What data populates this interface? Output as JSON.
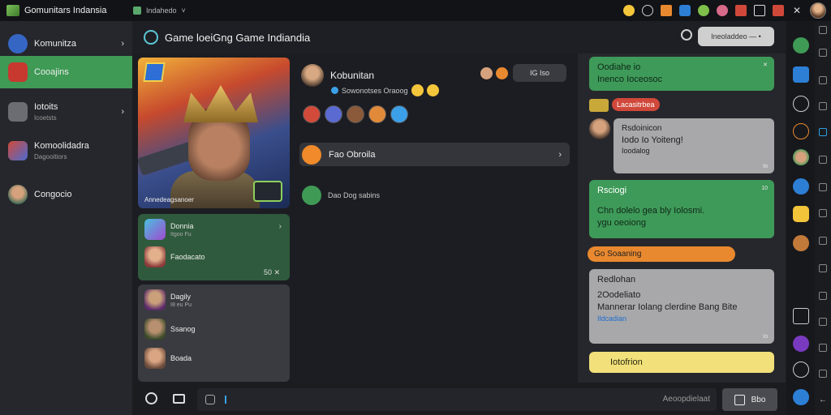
{
  "window": {
    "brand": "Gomunitars Indansia",
    "sub_title": "Indahedo",
    "sub_arrow": "˅"
  },
  "sidebar": {
    "items": [
      {
        "label": "Komunitza",
        "sub": "",
        "chevron": "›"
      },
      {
        "label": "Cooajins",
        "sub": ""
      },
      {
        "label": "Iotoits",
        "sub": "Icoetsts",
        "chevron": "›"
      },
      {
        "label": "Komoolidadra",
        "sub": "Dagooitiors"
      },
      {
        "label": "Congocio",
        "sub": ""
      }
    ]
  },
  "header": {
    "title": "Game loeiGng Game Indiandia",
    "button_label": "Ineoladdeo — •"
  },
  "hero": {
    "caption": "Annedeagsanoer"
  },
  "panel1": {
    "items": [
      {
        "label": "Donnia",
        "sub": "Itgoo Fu"
      },
      {
        "label": "Faodacato",
        "sub": ""
      }
    ],
    "footer": "50 ✕"
  },
  "panel2": {
    "items": [
      {
        "label": "Dagily",
        "sub": "I8 eu Pu"
      },
      {
        "label": "Ssanog",
        "sub": ""
      },
      {
        "label": "Boada",
        "sub": ""
      }
    ]
  },
  "middle": {
    "user_name": "Kobunitan",
    "status": "Sowonotses Oraoog",
    "pill_label": "IG Iso",
    "item_label": "Fao Obroila",
    "item_chevron": "›",
    "row2_label": "Dao Dog sabins"
  },
  "chat": {
    "msg1_line1": "Oodiahe io",
    "msg1_line2": "Inenco Ioceosoc",
    "tag_red": "Lacasitrbea",
    "msg2_name": "Rsdoinicon",
    "msg2_line1": "Iodo Io Yoiteng!",
    "msg2_line2": "Ioodalog",
    "msg2_time": "Io",
    "msg3_name": "Rsciogi",
    "msg3_line1": "Chn dolelo gea bly Iolosmi.",
    "msg3_line2": "ygu oeoiong",
    "msg3_time": "10",
    "tag_orange": "Go Soaaning",
    "msg4_name": "Redlohan",
    "msg4_line1": "2Oodeliato",
    "msg4_line2": "Mannerar Iolang clerdine Bang Bite",
    "msg4_link": "Ildcadian",
    "msg4_time": "Io",
    "msg5": "Iotofrion"
  },
  "bottom": {
    "placeholder": "Aeoopdielaat",
    "send_label": "Bbo"
  },
  "colors": {
    "accent_green": "#3e9a58",
    "grey_bubble": "#a8a8aa",
    "yellow_bubble": "#f2e07a",
    "orange_tag": "#e9892f",
    "red_tag": "#d0483a"
  },
  "icons": [
    "search-icon",
    "gear-icon",
    "close-icon",
    "minimize-icon",
    "maximize-icon",
    "chevron-right-icon",
    "send-icon",
    "emoji-icon"
  ]
}
